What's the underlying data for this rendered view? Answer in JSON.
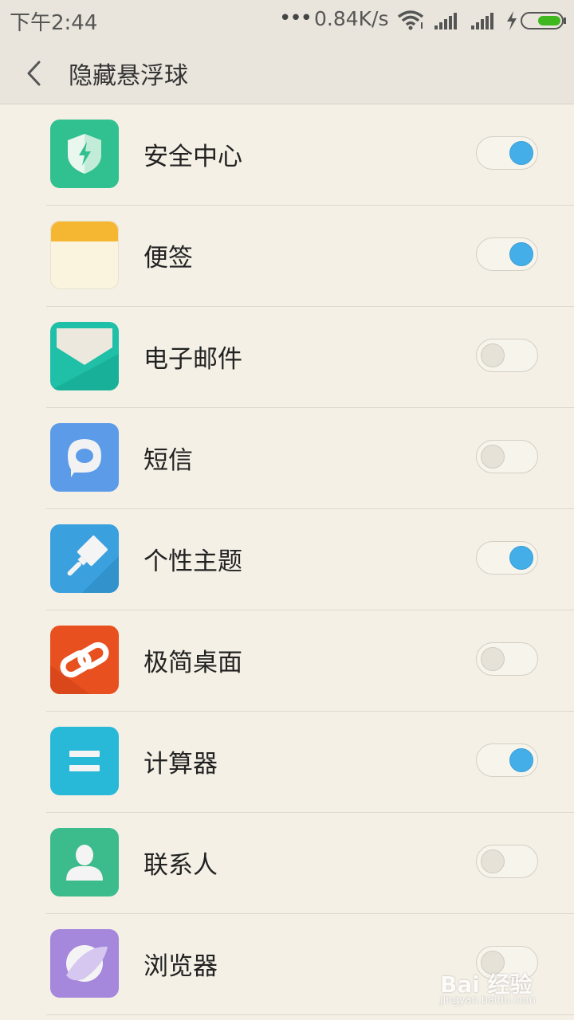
{
  "status_bar": {
    "time": "下午2:44",
    "dots": "•••",
    "speed": "0.84K/s",
    "icons": [
      "wifi-icon",
      "signal-icon",
      "signal-icon",
      "charge-icon",
      "battery-icon"
    ],
    "battery_color": "#3fb81f"
  },
  "header": {
    "back_icon": "chevron-left-icon",
    "title": "隐藏悬浮球"
  },
  "apps": [
    {
      "label": "安全中心",
      "icon": "shield-icon",
      "color": "#31c08f",
      "enabled": true
    },
    {
      "label": "便签",
      "icon": "notes-icon",
      "color": "#f5b632",
      "enabled": true
    },
    {
      "label": "电子邮件",
      "icon": "mail-icon",
      "color": "#1fbfa8",
      "enabled": false
    },
    {
      "label": "短信",
      "icon": "message-icon",
      "color": "#5b9be8",
      "enabled": false
    },
    {
      "label": "个性主题",
      "icon": "brush-icon",
      "color": "#3aa0de",
      "enabled": true
    },
    {
      "label": "极简桌面",
      "icon": "link-icon",
      "color": "#e8501f",
      "enabled": false
    },
    {
      "label": "计算器",
      "icon": "equals-icon",
      "color": "#28b8d8",
      "enabled": true
    },
    {
      "label": "联系人",
      "icon": "person-icon",
      "color": "#3cbb8c",
      "enabled": false
    },
    {
      "label": "浏览器",
      "icon": "planet-icon",
      "color": "#a587dc",
      "enabled": false
    }
  ],
  "watermark": {
    "main": "Bai 经验",
    "sub": "jingyan.baidu.com"
  }
}
